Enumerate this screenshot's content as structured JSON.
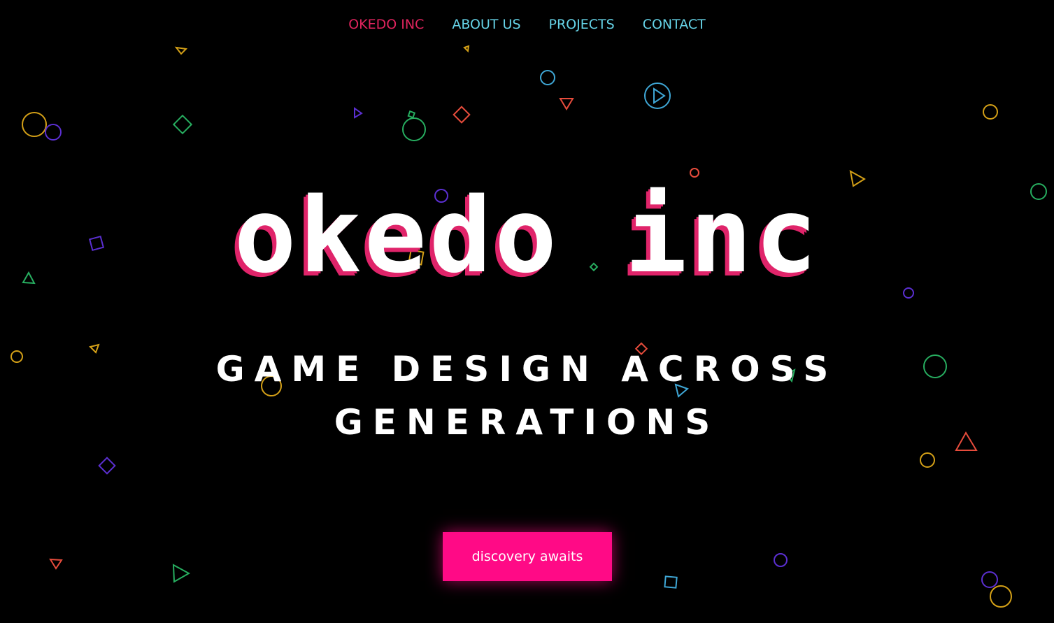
{
  "nav": {
    "brand": "OKEDO INC",
    "links": [
      "ABOUT US",
      "PROJECTS",
      "CONTACT"
    ]
  },
  "hero": {
    "logo_text": "okedo inc",
    "tagline_line1": "GAME DESIGN ACROSS",
    "tagline_line2": "GENERATIONS",
    "cta_label": "discovery awaits"
  },
  "colors": {
    "background": "#000000",
    "brand": "#e0245e",
    "nav_link": "#66d4e8",
    "cta": "#ff0a86",
    "logo_shadow": "#e0246a",
    "shape_palette": [
      "#d4a017",
      "#5b2fd1",
      "#27ae60",
      "#e74c3c",
      "#3fa7d6"
    ]
  },
  "icons": {
    "decor": [
      "circle-outline-icon",
      "triangle-outline-icon",
      "square-outline-icon",
      "diamond-outline-icon"
    ],
    "play": "play-circle-icon"
  }
}
